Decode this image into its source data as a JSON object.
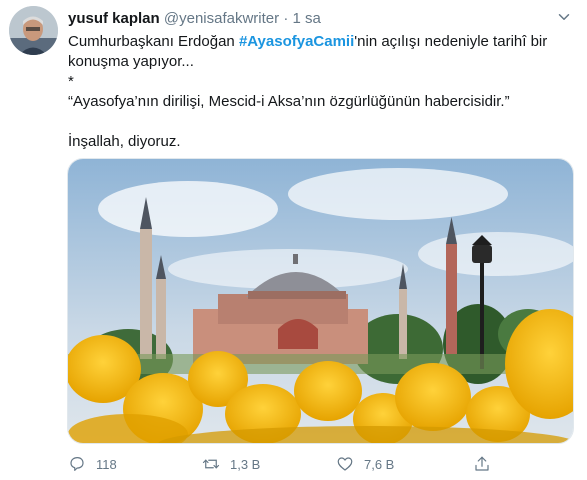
{
  "tweet": {
    "name": "yusuf kaplan",
    "handle": "@yenisafakwriter",
    "separator": "·",
    "time": "1 sa",
    "text": {
      "line1_prefix": "Cumhurbaşkanı Erdoğan ",
      "hashtag": "#AyasofyaCamii",
      "line1_suffix": "'nin açılışı nedeniyle tarihî bir",
      "line2": "konuşma yapıyor...",
      "line3": "*",
      "quote": "“Ayasofya’nın dirilişi, Mescid-i Aksa’nın özgürlüğünün habercisidir.”",
      "closing": "İnşallah, diyoruz."
    },
    "actions": {
      "reply_count": "118",
      "retweet_count": "1,3 B",
      "like_count": "7,6 B"
    }
  },
  "colors": {
    "link": "#1b95e0",
    "secondary": "#657786",
    "text": "#14171a"
  },
  "icons": [
    "caret-down-icon",
    "reply-icon",
    "retweet-icon",
    "like-icon",
    "share-icon"
  ]
}
